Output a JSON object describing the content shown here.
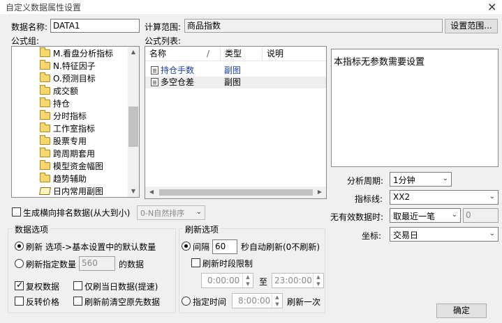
{
  "window": {
    "title": "自定义数据属性设置",
    "close_label": "×"
  },
  "data_name": {
    "label": "数据名称:",
    "value": "DATA1"
  },
  "calc_range": {
    "label": "计算范围:",
    "value": "商品指数",
    "button": "设置范围..."
  },
  "formula_group": {
    "label": "公式组:",
    "items": [
      {
        "label": "M.看盘分析指标",
        "icon": "folder-icon"
      },
      {
        "label": "N.特征因子",
        "icon": "folder-icon"
      },
      {
        "label": "O.预测目标",
        "icon": "folder-icon"
      },
      {
        "label": "成交额",
        "icon": "folder-icon"
      },
      {
        "label": "持仓",
        "icon": "folder-icon"
      },
      {
        "label": "分时指标",
        "icon": "folder-icon"
      },
      {
        "label": "工作室指标",
        "icon": "folder-icon"
      },
      {
        "label": "股票专用",
        "icon": "folder-icon"
      },
      {
        "label": "跨周期套用",
        "icon": "folder-icon"
      },
      {
        "label": "模型资金幅图",
        "icon": "folder-icon"
      },
      {
        "label": "趋势辅助",
        "icon": "folder-icon"
      },
      {
        "label": "日内常用副图",
        "icon": "book-icon"
      }
    ]
  },
  "formula_list": {
    "label": "公式列表:",
    "columns": [
      "名称",
      "/",
      "类型",
      "说明"
    ],
    "rows": [
      {
        "name": "持仓手数",
        "type": "副图",
        "desc": ""
      },
      {
        "name": "多空仓差",
        "type": "副图",
        "desc": ""
      }
    ]
  },
  "param_note": "本指标无参数需要设置",
  "generate_rank": {
    "label": "生成横向排名数据(从大到小)",
    "checked": false,
    "select_value": "0-N自然排序"
  },
  "analysis_period": {
    "label": "分析周期:",
    "value": "1分钟"
  },
  "indicator_line": {
    "label": "指标线:",
    "value": "XX2"
  },
  "no_valid_data": {
    "label": "无有效数据时:",
    "value": "取最近一笔",
    "extra_value": "0"
  },
  "coordinate": {
    "label": "坐标:",
    "value": "交易日"
  },
  "data_options": {
    "title": "数据选项",
    "refresh_label": "刷新 选项->基本设置中的默认数量",
    "refresh_count_label": "刷新指定数量",
    "refresh_count_value": "560",
    "refresh_count_suffix": "的数据",
    "adjust_label": "复权数据",
    "today_only_label": "仅刷当日数据(提速)",
    "reverse_label": "反转价格",
    "clear_before_label": "刷新前清空原先数据"
  },
  "refresh_options": {
    "title": "刷新选项",
    "interval_label": "间隔",
    "interval_value": "60",
    "interval_suffix": "秒自动刷新(0不刷新)",
    "period_limit_label": "刷新时段限制",
    "start_time": "0:00:00",
    "to_label": "至",
    "end_time": "23:00:00",
    "specified_label": "指定时间",
    "specified_value": "8:00:00",
    "specified_suffix": "刷新一次"
  },
  "ok_button": "确定"
}
